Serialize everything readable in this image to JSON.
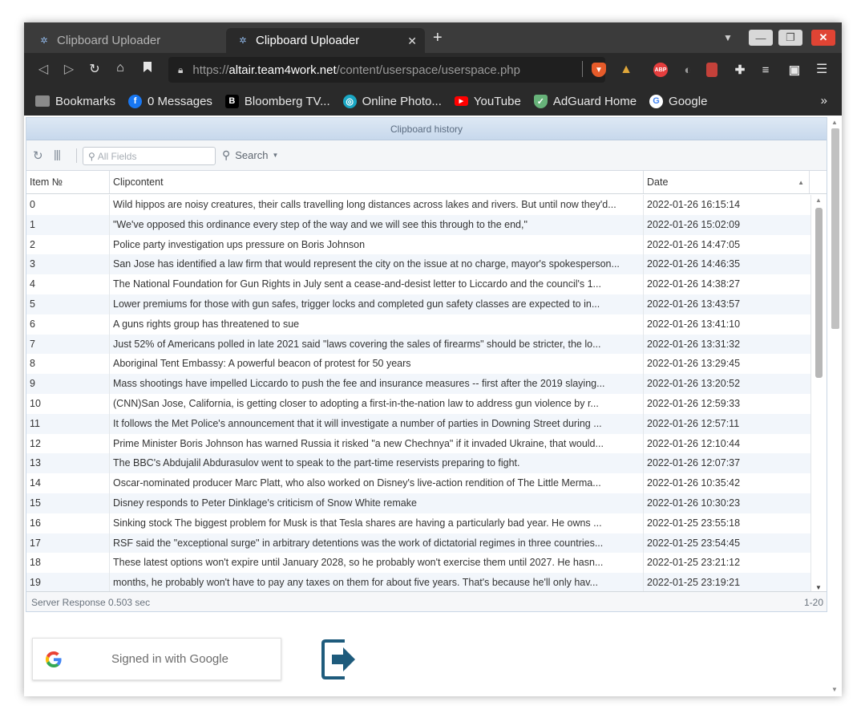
{
  "browser": {
    "tabs": [
      {
        "label": "Clipboard Uploader",
        "active": false
      },
      {
        "label": "Clipboard Uploader",
        "active": true
      }
    ],
    "new_tab_symbol": "+",
    "url": {
      "prefix": "https://",
      "host": "altair.team4work.net",
      "path": "/content/userspace/userspace.php"
    },
    "bookmarks": [
      {
        "label": "Bookmarks",
        "icon": "folder-icon"
      },
      {
        "label": "0 Messages",
        "icon": "facebook-icon"
      },
      {
        "label": "Bloomberg TV...",
        "icon": "bloomberg-icon"
      },
      {
        "label": "Online Photo...",
        "icon": "photo-editor-icon"
      },
      {
        "label": "YouTube",
        "icon": "youtube-icon"
      },
      {
        "label": "AdGuard Home",
        "icon": "adguard-icon"
      },
      {
        "label": "Google",
        "icon": "google-icon"
      }
    ],
    "colors": {
      "chrome_dark": "#2a2a2a",
      "tab_strip": "#3b3b3b",
      "close_red": "#e04434"
    }
  },
  "grid": {
    "title": "Clipboard history",
    "search_placeholder": "All Fields",
    "search_label": "Search",
    "columns": {
      "item": "Item №",
      "clip": "Clipcontent",
      "date": "Date"
    },
    "rows": [
      {
        "item": "0",
        "clip": "Wild hippos are noisy creatures, their calls travelling long distances across lakes and rivers. But until now they'd...",
        "date": "2022-01-26 16:15:14"
      },
      {
        "item": "1",
        "clip": "\"We've opposed this ordinance every step of the way and we will see this through to the end,\"",
        "date": "2022-01-26 15:02:09"
      },
      {
        "item": "2",
        "clip": "Police party investigation ups pressure on Boris Johnson",
        "date": "2022-01-26 14:47:05"
      },
      {
        "item": "3",
        "clip": "San Jose has identified a law firm that would represent the city on the issue at no charge, mayor's spokesperson...",
        "date": "2022-01-26 14:46:35"
      },
      {
        "item": "4",
        "clip": "The National Foundation for Gun Rights in July sent a cease-and-desist letter to Liccardo and the council's 1...",
        "date": "2022-01-26 14:38:27"
      },
      {
        "item": "5",
        "clip": "Lower premiums for those with gun safes, trigger locks and completed gun safety classes are expected to in...",
        "date": "2022-01-26 13:43:57"
      },
      {
        "item": "6",
        "clip": "A guns rights group has threatened to sue",
        "date": "2022-01-26 13:41:10"
      },
      {
        "item": "7",
        "clip": "Just 52% of Americans polled in late 2021 said \"laws covering the sales of firearms\" should be stricter, the lo...",
        "date": "2022-01-26 13:31:32"
      },
      {
        "item": "8",
        "clip": "Aboriginal Tent Embassy: A powerful beacon of protest for 50 years",
        "date": "2022-01-26 13:29:45"
      },
      {
        "item": "9",
        "clip": "Mass shootings have impelled Liccardo to push the fee and insurance measures -- first after the 2019 slaying...",
        "date": "2022-01-26 13:20:52"
      },
      {
        "item": "10",
        "clip": "(CNN)San Jose, California, is getting closer to adopting a first-in-the-nation law to address gun violence by r...",
        "date": "2022-01-26 12:59:33"
      },
      {
        "item": "11",
        "clip": "It follows the Met Police's announcement that it will investigate a number of parties in Downing Street during ...",
        "date": "2022-01-26 12:57:11"
      },
      {
        "item": "12",
        "clip": "Prime Minister Boris Johnson has warned Russia it risked \"a new Chechnya\" if it invaded Ukraine, that would...",
        "date": "2022-01-26 12:10:44"
      },
      {
        "item": "13",
        "clip": "The BBC's Abdujalil Abdurasulov went to speak to the part-time reservists preparing to fight.",
        "date": "2022-01-26 12:07:37"
      },
      {
        "item": "14",
        "clip": "Oscar-nominated producer Marc Platt, who also worked on Disney's live-action rendition of The Little Merma...",
        "date": "2022-01-26 10:35:42"
      },
      {
        "item": "15",
        "clip": "Disney responds to Peter Dinklage's criticism of Snow White remake",
        "date": "2022-01-26 10:30:23"
      },
      {
        "item": "16",
        "clip": "Sinking stock The biggest problem for Musk is that Tesla shares are having a particularly bad year. He owns ...",
        "date": "2022-01-25 23:55:18"
      },
      {
        "item": "17",
        "clip": "RSF said the \"exceptional surge\" in arbitrary detentions was the work of dictatorial regimes in three countries...",
        "date": "2022-01-25 23:54:45"
      },
      {
        "item": "18",
        "clip": "These latest options won't expire until January 2028, so he probably won't exercise them until 2027. He hasn...",
        "date": "2022-01-25 23:21:12"
      },
      {
        "item": "19",
        "clip": "months, he probably won't have to pay any taxes on them for about five years. That's because he'll only hav...",
        "date": "2022-01-25 23:19:21"
      }
    ],
    "footer_status": "Server Response 0.503 sec",
    "footer_range": "1-20"
  },
  "signin": {
    "label": "Signed in with Google"
  },
  "colors": {
    "accent": "#1e5b7c",
    "header_gradient_top": "#dde8f4",
    "row_alt": "#f2f6fb"
  }
}
